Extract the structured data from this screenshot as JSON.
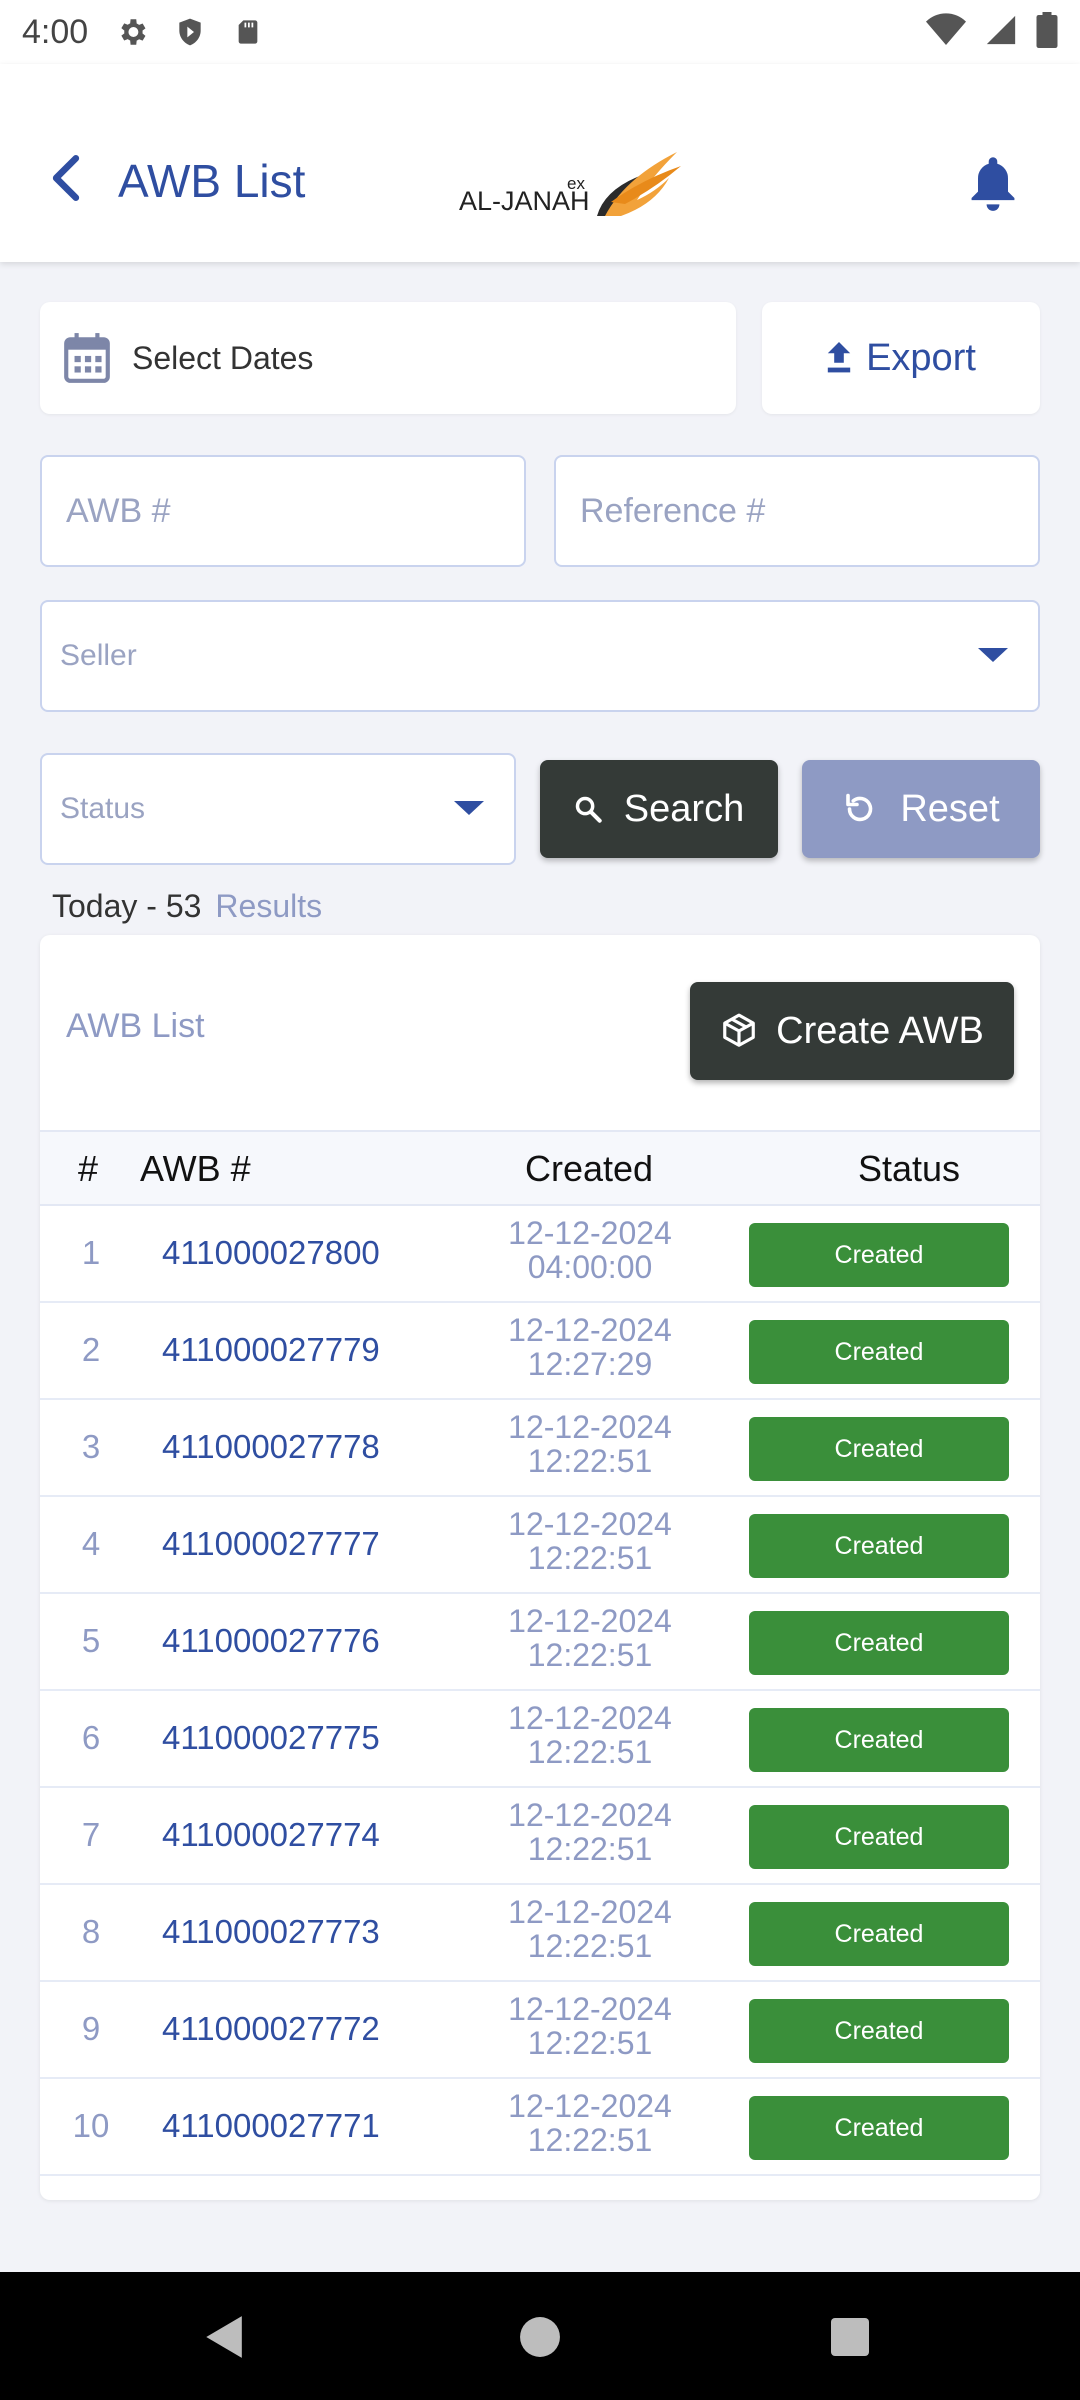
{
  "status_bar": {
    "time": "4:00"
  },
  "header": {
    "title": "AWB List",
    "logo_text": "AL-JANAH",
    "logo_sup": "ex"
  },
  "filters": {
    "dates_label": "Select Dates",
    "export_label": "Export",
    "awb_placeholder": "AWB #",
    "reference_placeholder": "Reference #",
    "seller_label": "Seller",
    "status_label": "Status",
    "search_label": "Search",
    "reset_label": "Reset"
  },
  "summary": {
    "today": "Today - 53",
    "results": "Results"
  },
  "list": {
    "title": "AWB List",
    "create_label": "Create AWB",
    "columns": [
      "#",
      "AWB #",
      "Created",
      "Status"
    ],
    "rows": [
      {
        "num": "1",
        "awb": "411000027800",
        "date": "12-12-2024",
        "time": "04:00:00",
        "status": "Created"
      },
      {
        "num": "2",
        "awb": "411000027779",
        "date": "12-12-2024",
        "time": "12:27:29",
        "status": "Created"
      },
      {
        "num": "3",
        "awb": "411000027778",
        "date": "12-12-2024",
        "time": "12:22:51",
        "status": "Created"
      },
      {
        "num": "4",
        "awb": "411000027777",
        "date": "12-12-2024",
        "time": "12:22:51",
        "status": "Created"
      },
      {
        "num": "5",
        "awb": "411000027776",
        "date": "12-12-2024",
        "time": "12:22:51",
        "status": "Created"
      },
      {
        "num": "6",
        "awb": "411000027775",
        "date": "12-12-2024",
        "time": "12:22:51",
        "status": "Created"
      },
      {
        "num": "7",
        "awb": "411000027774",
        "date": "12-12-2024",
        "time": "12:22:51",
        "status": "Created"
      },
      {
        "num": "8",
        "awb": "411000027773",
        "date": "12-12-2024",
        "time": "12:22:51",
        "status": "Created"
      },
      {
        "num": "9",
        "awb": "411000027772",
        "date": "12-12-2024",
        "time": "12:22:51",
        "status": "Created"
      },
      {
        "num": "10",
        "awb": "411000027771",
        "date": "12-12-2024",
        "time": "12:22:51",
        "status": "Created"
      }
    ]
  },
  "colors": {
    "primary": "#2f4ea1",
    "dark_button": "#343a37",
    "reset_button": "#8e9ac4",
    "status_green": "#3a8f3a",
    "muted": "#8e9ac4"
  }
}
